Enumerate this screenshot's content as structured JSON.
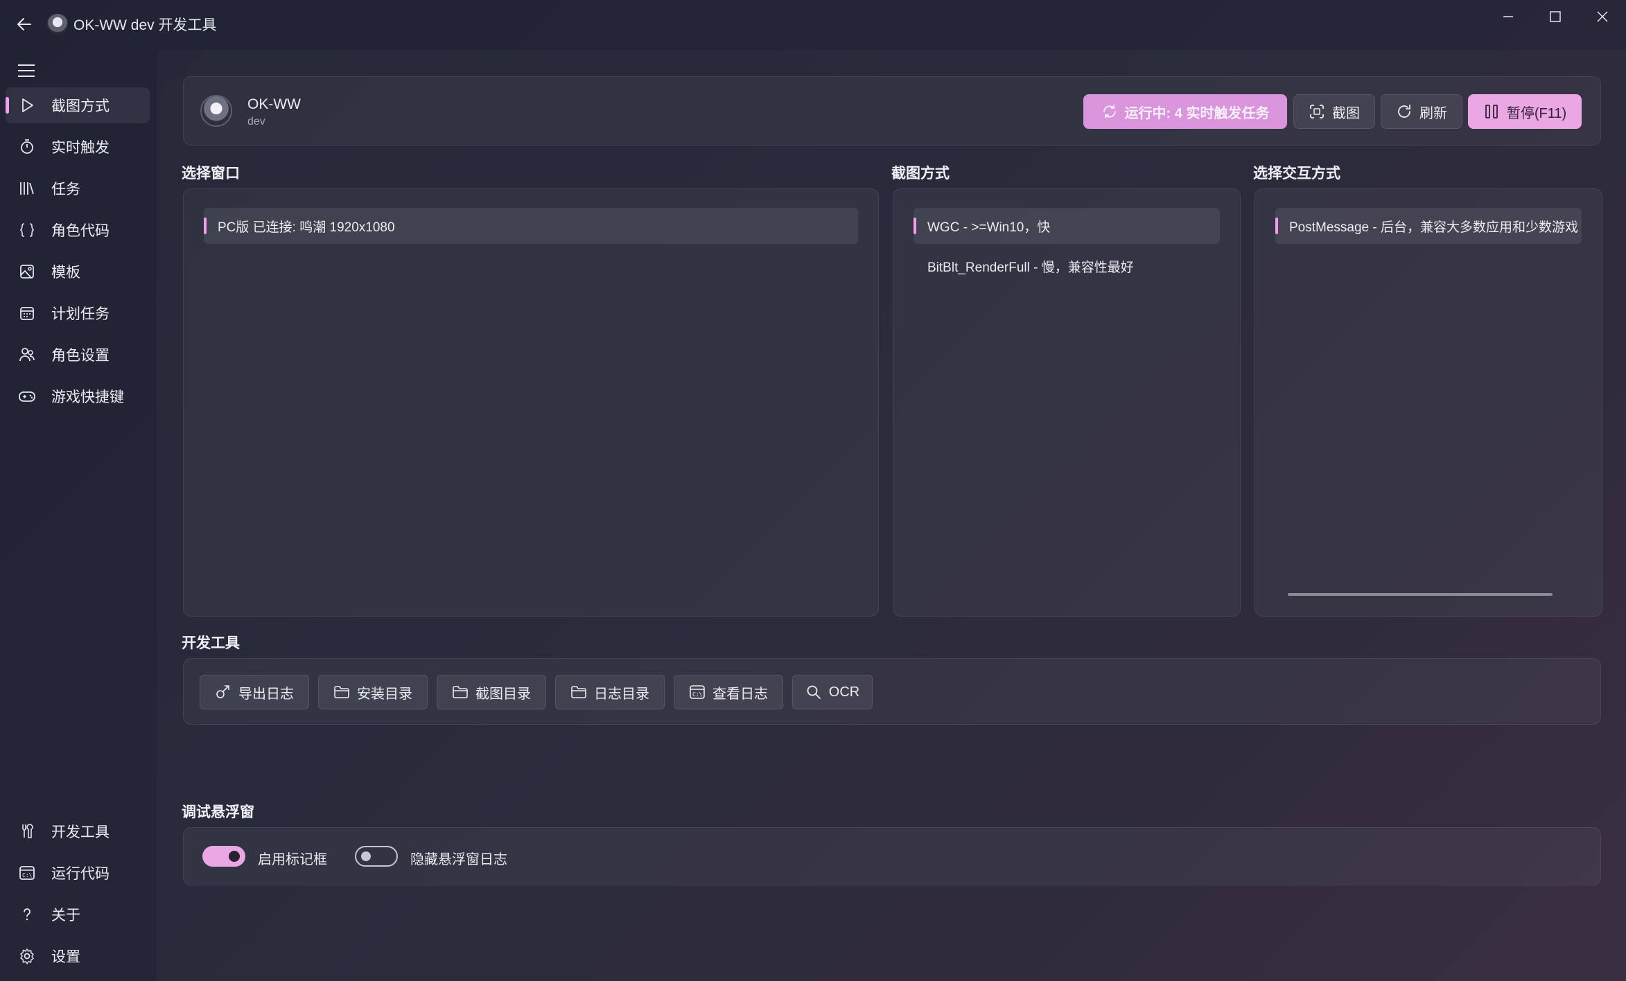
{
  "window": {
    "title": "OK-WW dev  开发工具"
  },
  "sidebar": {
    "items": [
      {
        "label": "截图方式",
        "icon": "play-icon",
        "active": true
      },
      {
        "label": "实时触发",
        "icon": "stopwatch-icon"
      },
      {
        "label": "任务",
        "icon": "library-icon"
      },
      {
        "label": "角色代码",
        "icon": "braces-icon"
      },
      {
        "label": "模板",
        "icon": "image-icon"
      },
      {
        "label": "计划任务",
        "icon": "calendar-icon"
      },
      {
        "label": "角色设置",
        "icon": "people-icon"
      },
      {
        "label": "游戏快捷键",
        "icon": "gamepad-icon"
      }
    ],
    "bottom_items": [
      {
        "label": "开发工具",
        "icon": "tools-icon"
      },
      {
        "label": "运行代码",
        "icon": "terminal-icon"
      },
      {
        "label": "关于",
        "icon": "question-icon"
      },
      {
        "label": "设置",
        "icon": "gear-icon"
      }
    ]
  },
  "header": {
    "app_name": "OK-WW",
    "app_sub": "dev",
    "running_label": "运行中: 4 实时触发任务",
    "screenshot_label": "截图",
    "refresh_label": "刷新",
    "pause_label": "暂停(F11)",
    "accent_color": "#eba6e4"
  },
  "sections": {
    "window_title": "选择窗口",
    "capture_title": "截图方式",
    "interaction_title": "选择交互方式",
    "devtools_title": "开发工具",
    "debug_title": "调试悬浮窗"
  },
  "window_list": [
    {
      "label": "PC版 已连接: 鸣潮    1920x1080",
      "selected": true
    }
  ],
  "capture_list": [
    {
      "label": "WGC - >=Win10，快",
      "selected": true
    },
    {
      "label": "BitBlt_RenderFull - 慢，兼容性最好",
      "selected": false
    }
  ],
  "interaction_list": [
    {
      "label": "PostMessage - 后台，兼容大多数应用和少数游戏",
      "selected": true
    }
  ],
  "dev_tools": [
    {
      "label": "导出日志",
      "icon": "export-icon"
    },
    {
      "label": "安装目录",
      "icon": "folder-icon"
    },
    {
      "label": "截图目录",
      "icon": "folder-icon"
    },
    {
      "label": "日志目录",
      "icon": "folder-icon"
    },
    {
      "label": "查看日志",
      "icon": "terminal-icon"
    },
    {
      "label": "OCR",
      "icon": "search-icon"
    }
  ],
  "debug": {
    "toggles": [
      {
        "label": "启用标记框",
        "on": true
      },
      {
        "label": "隐藏悬浮窗日志",
        "on": false
      }
    ]
  }
}
